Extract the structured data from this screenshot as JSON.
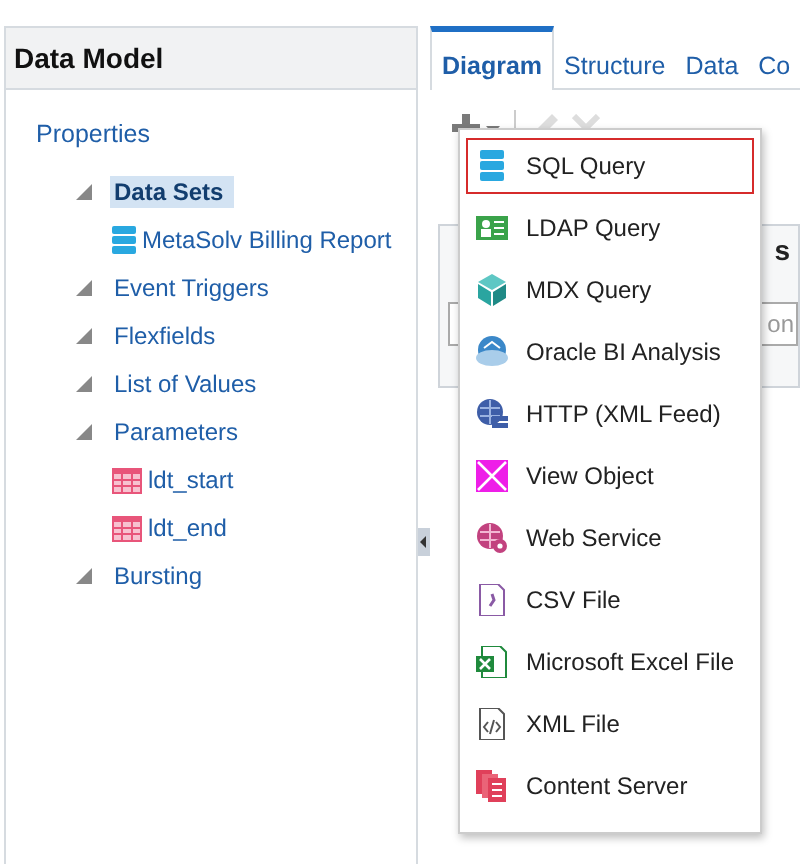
{
  "left_panel": {
    "title": "Data Model",
    "properties_link": "Properties",
    "sections": [
      {
        "label": "Data Sets",
        "expanded": true,
        "selected": true,
        "children": [
          {
            "label": "MetaSolv Billing Report",
            "kind": "dataset"
          }
        ]
      },
      {
        "label": "Event Triggers",
        "expanded": true,
        "selected": false
      },
      {
        "label": "Flexfields",
        "expanded": true,
        "selected": false
      },
      {
        "label": "List of Values",
        "expanded": true,
        "selected": false
      },
      {
        "label": "Parameters",
        "expanded": true,
        "selected": false,
        "children": [
          {
            "label": "ldt_start",
            "kind": "parameter"
          },
          {
            "label": "ldt_end",
            "kind": "parameter"
          }
        ]
      },
      {
        "label": "Bursting",
        "expanded": true,
        "selected": false
      }
    ]
  },
  "tabs": [
    {
      "label": "Diagram",
      "selected": true
    },
    {
      "label": "Structure",
      "selected": false
    },
    {
      "label": "Data",
      "selected": false
    },
    {
      "label": "Co",
      "selected": false
    }
  ],
  "background_panel": {
    "header_fragment": "s",
    "field_fragment": "on"
  },
  "menu": {
    "items": [
      {
        "label": "SQL Query",
        "kind": "sql",
        "selected": true
      },
      {
        "label": "LDAP Query",
        "kind": "ldap",
        "selected": false
      },
      {
        "label": "MDX Query",
        "kind": "mdx",
        "selected": false
      },
      {
        "label": "Oracle BI Analysis",
        "kind": "analysis",
        "selected": false
      },
      {
        "label": "HTTP (XML Feed)",
        "kind": "http",
        "selected": false
      },
      {
        "label": "View Object",
        "kind": "view",
        "selected": false
      },
      {
        "label": "Web Service",
        "kind": "webservice",
        "selected": false
      },
      {
        "label": "CSV File",
        "kind": "csv",
        "selected": false
      },
      {
        "label": "Microsoft Excel File",
        "kind": "excel",
        "selected": false
      },
      {
        "label": "XML File",
        "kind": "xml",
        "selected": false
      },
      {
        "label": "Content Server",
        "kind": "content",
        "selected": false
      }
    ]
  }
}
